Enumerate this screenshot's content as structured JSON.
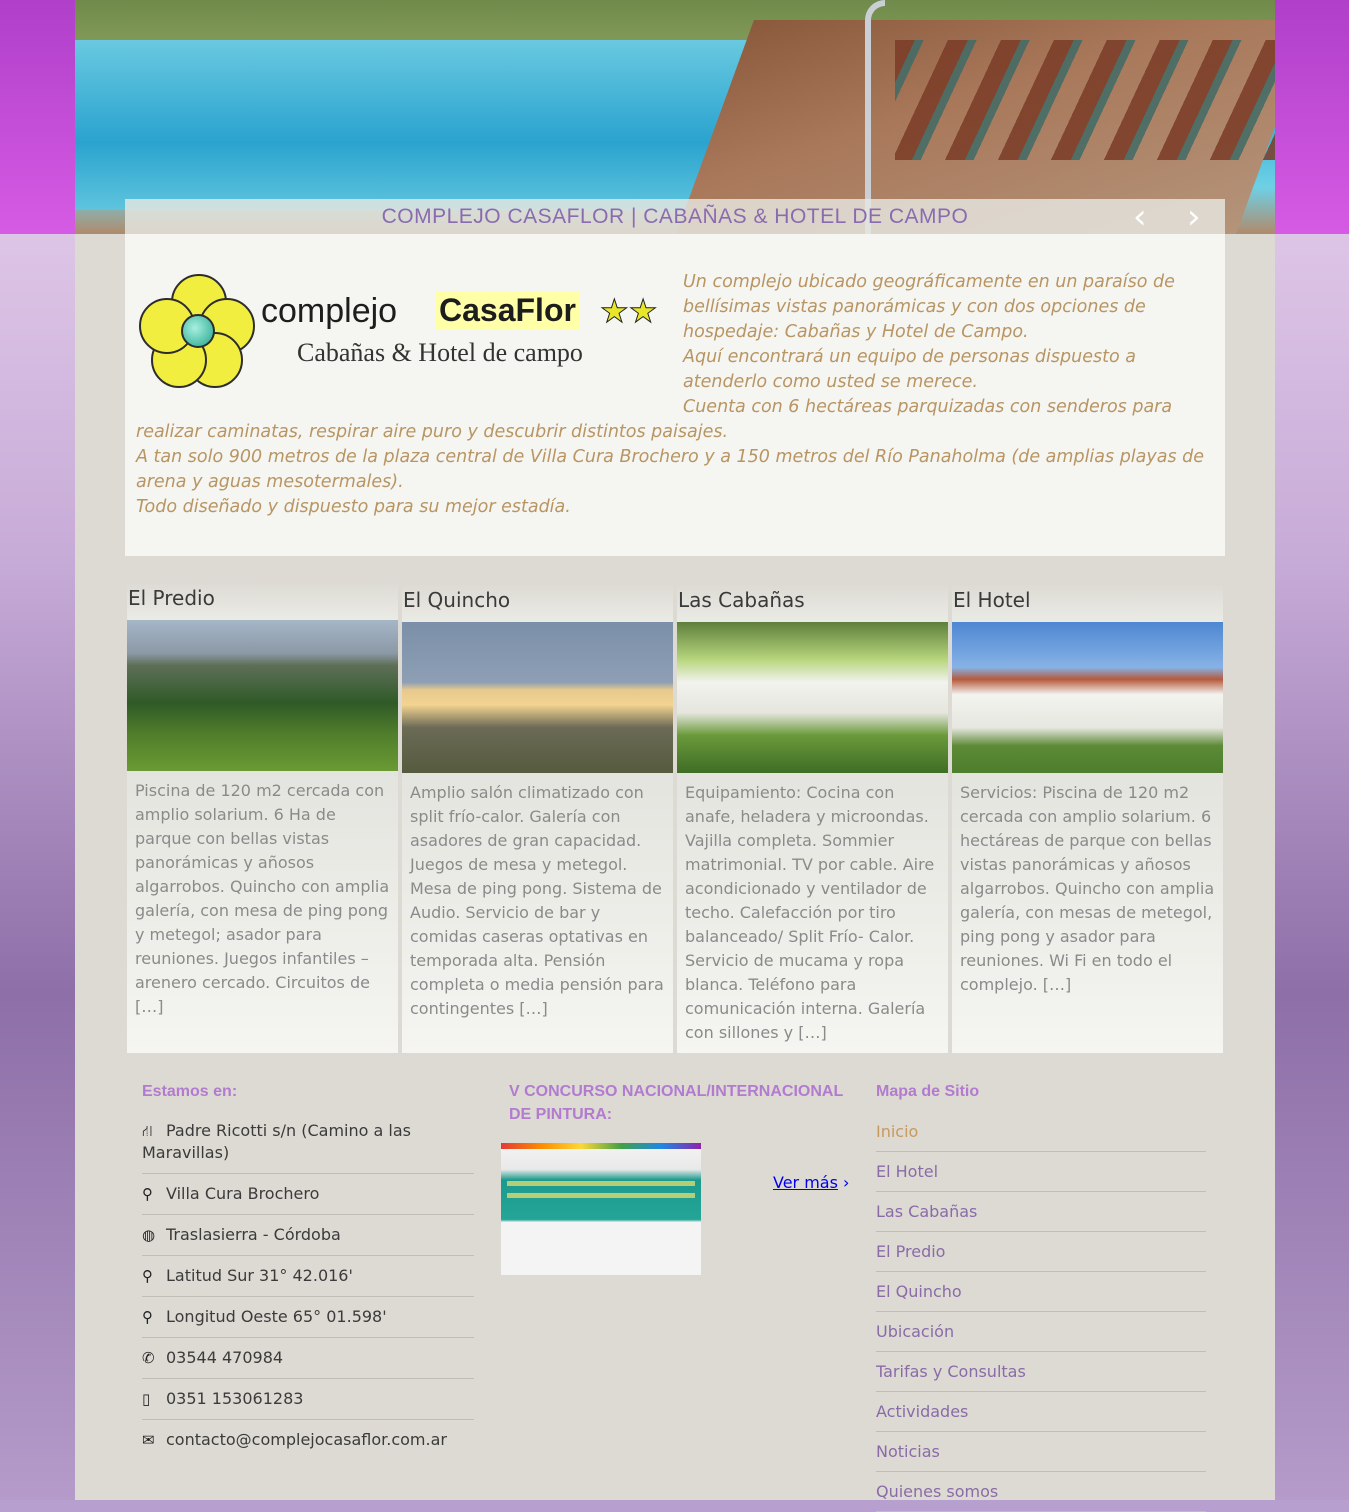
{
  "hero": {
    "title": "COMPLEJO CASAFLOR | CABAÑAS & HOTEL DE CAMPO",
    "prev_label": "‹",
    "next_label": "›"
  },
  "logo": {
    "word1": "complejo",
    "word2": "CasaFlor",
    "stars": "★★",
    "subtitle": "Cabañas & Hotel de campo"
  },
  "intro": {
    "paragraphs": [
      "Un complejo ubicado geográficamente en un paraíso de bellísimas vistas panorámicas y con dos opciones de hospedaje: Cabañas y Hotel de Campo.",
      "Aquí encontrará un equipo de personas dispuesto a atenderlo como usted se merece.",
      "Cuenta con 6 hectáreas parquizadas con senderos para realizar caminatas, respirar aire puro y descubrir distintos paisajes.",
      "A tan solo 900 metros de la plaza central de Villa Cura Brochero y a 150 metros del Río Panaholma (de amplias playas de arena y aguas mesotermales).",
      "Todo diseñado y dispuesto para su mejor estadía."
    ]
  },
  "cards": [
    {
      "title": "El Predio",
      "text": "Piscina de 120 m2 cercada con amplio solarium. 6 Ha de parque con bellas vistas panorámicas y añosos algarrobos. Quincho con amplia galería, con mesa de ping pong y metegol; asador para reuniones. Juegos infantiles – arenero cercado. Circuitos de",
      "more": "[…]"
    },
    {
      "title": "El Quincho",
      "text": "Amplio salón climatizado con split frío-calor. Galería con asadores de gran capacidad. Juegos de mesa y metegol. Mesa de ping pong. Sistema de Audio. Servicio de bar y comidas caseras optativas en temporada alta. Pensión completa o media pensión para contingentes",
      "more": "[…]"
    },
    {
      "title": "Las Cabañas",
      "text": "Equipamiento: Cocina con anafe, heladera y microondas. Vajilla completa. Sommier matrimonial. TV por cable. Aire acondicionado y ventilador de techo. Calefacción por tiro balanceado/ Split Frío- Calor. Servicio de mucama y ropa blanca. Teléfono para comunicación interna. Galería con sillones y",
      "more": "[…]"
    },
    {
      "title": "El Hotel",
      "text": "Servicios: Piscina de 120 m2 cercada con amplio solarium. 6 hectáreas de parque con bellas vistas panorámicas y añosos algarrobos. Quincho con amplia galería, con mesas de metegol, ping pong y asador para reuniones. Wi Fi en todo el complejo.",
      "more": "[…]"
    }
  ],
  "footer": {
    "contact_title": "Estamos en:",
    "contact": [
      {
        "icon": "road-icon",
        "glyph": "⛙",
        "text": "Padre Ricotti s/n (Camino a las Maravillas)"
      },
      {
        "icon": "map-marker-icon",
        "glyph": "⚲",
        "text": "Villa Cura Brochero"
      },
      {
        "icon": "globe-icon",
        "glyph": "◍",
        "text": "Traslasierra - Córdoba"
      },
      {
        "icon": "map-marker-icon",
        "glyph": "⚲",
        "text": "Latitud Sur 31° 42.016'"
      },
      {
        "icon": "map-marker-icon",
        "glyph": "⚲",
        "text": "Longitud Oeste 65° 01.598'"
      },
      {
        "icon": "phone-icon",
        "glyph": "✆",
        "text": "03544 470984"
      },
      {
        "icon": "mobile-icon",
        "glyph": "▯",
        "text": "0351 153061283"
      },
      {
        "icon": "envelope-icon",
        "glyph": "✉",
        "text": "contacto@complejocasaflor.com.ar"
      }
    ],
    "contest_title": "V CONCURSO NACIONAL/INTERNACIONAL DE PINTURA:",
    "see_more": "Ver más",
    "see_more_arrow": "›",
    "sitemap_title": "Mapa de Sitio",
    "sitemap": [
      {
        "label": "Inicio",
        "active": true
      },
      {
        "label": "El Hotel"
      },
      {
        "label": "Las Cabañas"
      },
      {
        "label": "El Predio"
      },
      {
        "label": "El Quincho"
      },
      {
        "label": "Ubicación"
      },
      {
        "label": "Tarifas y Consultas"
      },
      {
        "label": "Actividades"
      },
      {
        "label": "Noticias"
      },
      {
        "label": "Quienes somos"
      }
    ]
  },
  "colors": {
    "accent_purple": "#8a6bb0",
    "intro_text": "#b89563",
    "active_link": "#c79a5e"
  }
}
